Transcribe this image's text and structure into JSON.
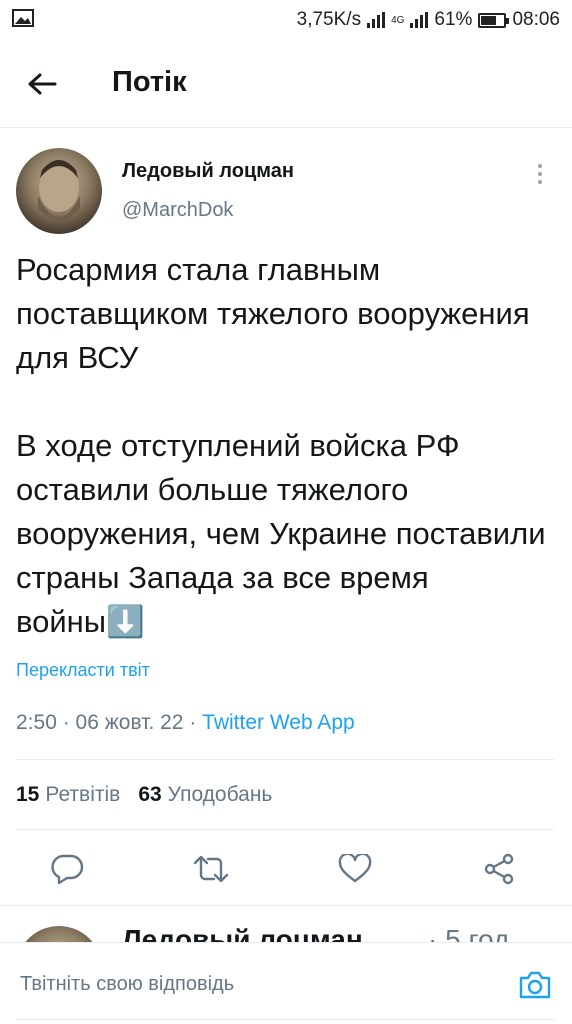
{
  "status_bar": {
    "speed": "3,75K/s",
    "network": "4G",
    "battery": "61%",
    "battery_level": 0.61,
    "time": "08:06"
  },
  "header": {
    "title": "Потік"
  },
  "tweet": {
    "author_name": "Ледовый лоцман",
    "author_handle": "@MarchDok",
    "text": "Росармия стала главным поставщиком тяжелого вооружения для ВСУ\n\nВ ходе отступлений войска РФ оставили больше тяжелого вооружения, чем Украине поставили страны Запада за все время войны⬇️",
    "translate_label": "Перекласти твіт",
    "time": "2:50",
    "date": "06 жовт. 22",
    "source": "Twitter Web App",
    "retweets_count": "15",
    "retweets_label": "Ретвітів",
    "likes_count": "63",
    "likes_label": "Уподобань"
  },
  "next_tweet": {
    "author_name": "Ледовый лоцман",
    "time": "· 5 год"
  },
  "reply": {
    "placeholder": "Твітніть свою відповідь"
  },
  "colors": {
    "accent": "#1da1f2",
    "secondary_text": "#657786",
    "divider": "#e6ecf0"
  }
}
